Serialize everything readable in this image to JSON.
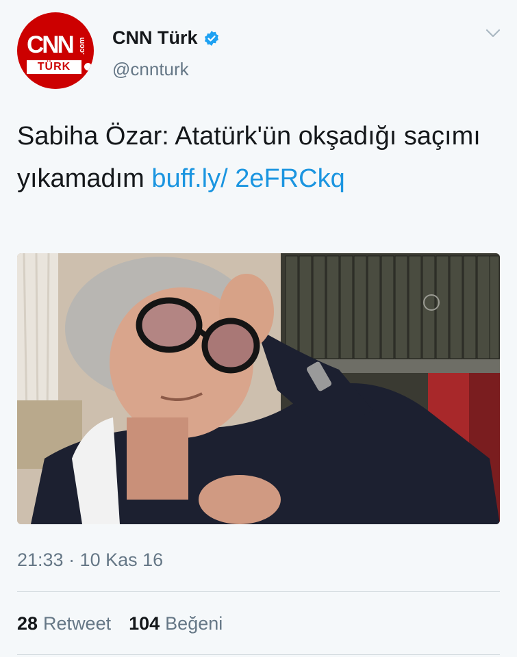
{
  "account": {
    "display_name": "CNN Türk",
    "handle": "@cnnturk",
    "avatar_text": "CNN",
    "avatar_sub": "TÜRK",
    "avatar_com": ".com"
  },
  "tweet": {
    "text": "Sabiha Özar: Atatürk'ün okşadığı saçımı yıkamadım ",
    "link": "buff.ly/ 2eFRCkq",
    "timestamp": "21:33 · 10 Kas 16"
  },
  "stats": {
    "retweet_count": "28",
    "retweet_label": "Retweet",
    "like_count": "104",
    "like_label": "Beğeni"
  },
  "colors": {
    "brand_red": "#cc0000",
    "link_blue": "#1b95e0",
    "verified_blue": "#1da1f2",
    "muted": "#657786"
  },
  "icons": {
    "verified": "verified-badge-icon",
    "menu": "chevron-down-icon"
  }
}
